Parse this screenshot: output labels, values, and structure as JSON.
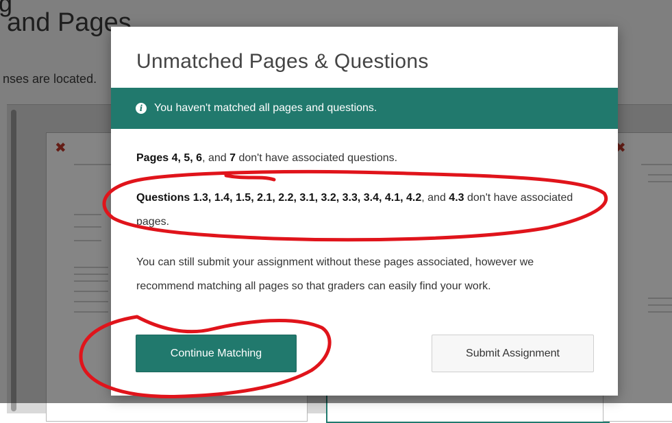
{
  "background": {
    "title_fragment": "g",
    "heading": "and Pages",
    "subtext": "nses are located."
  },
  "modal": {
    "title": "Unmatched Pages & Questions",
    "alert": {
      "icon": "info-icon",
      "text": "You haven't matched all pages and questions."
    },
    "pages_msg": {
      "bold": "Pages 4, 5, 6",
      "mid": ", and ",
      "bold2": "7",
      "rest": " don't have associated questions."
    },
    "questions_msg": {
      "label": "Questions",
      "list": "1.3, 1.4, 1.5, 2.1, 2.2, 3.1, 3.2, 3.3, 3.4, 4.1, 4.2",
      "mid": ", and ",
      "last": "4.3",
      "rest": " don't have associated pages."
    },
    "recommendation": "You can still submit your assignment without these pages associated, however we recommend matching all pages so that graders can easily find your work.",
    "buttons": {
      "continue": "Continue Matching",
      "submit": "Submit Assignment"
    }
  },
  "colors": {
    "accent": "#21796d",
    "annotation": "#e0141b"
  }
}
